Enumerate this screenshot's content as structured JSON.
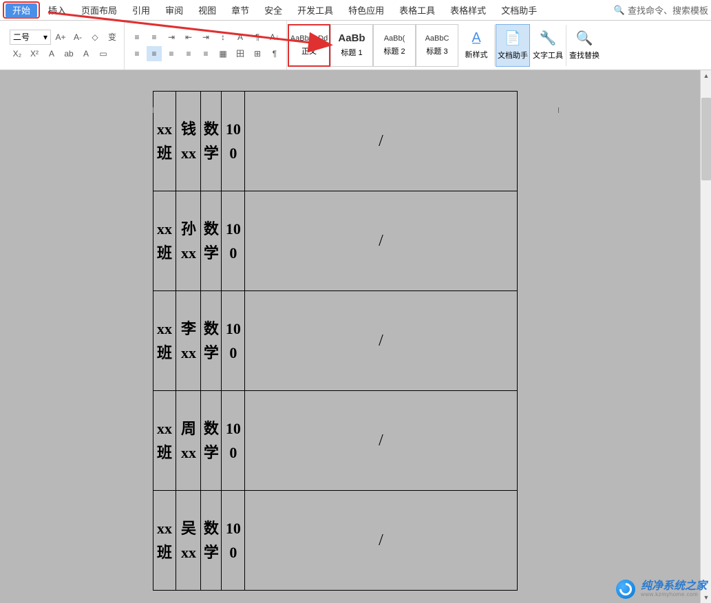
{
  "menu": {
    "items": [
      "开始",
      "插入",
      "页面布局",
      "引用",
      "审阅",
      "视图",
      "章节",
      "安全",
      "开发工具",
      "特色应用",
      "表格工具",
      "表格样式",
      "文档助手"
    ],
    "search_placeholder": "查找命令、搜索模板"
  },
  "ribbon": {
    "font_size": "二号",
    "a_plus": "A+",
    "a_minus": "A-",
    "clear_fmt": "◇",
    "phonetic": "变",
    "row2": {
      "sub": "X₂",
      "sup": "X²",
      "fontA": "A",
      "highlight": "ab",
      "fontcolor": "A",
      "brush": "▭"
    },
    "para": {
      "bullets": "≡",
      "numbers": "≡",
      "align_dec": "⇥",
      "indent_dec": "⇤",
      "indent_inc": "⇥",
      "linespace": "↕",
      "align_l": "≡",
      "align_c": "≡",
      "align_r": "≡",
      "justify": "≡",
      "dist": "≡",
      "shade": "▦",
      "border": "田",
      "para_btn": "¶",
      "sort": "A↓"
    },
    "styles": [
      {
        "preview": "AaBbCcDd",
        "name": "正文",
        "bold": false,
        "selected": true
      },
      {
        "preview": "AaBb",
        "name": "标题 1",
        "bold": true,
        "selected": false
      },
      {
        "preview": "AaBb(",
        "name": "标题 2",
        "bold": false,
        "selected": false
      },
      {
        "preview": "AaBbC",
        "name": "标题 3",
        "bold": false,
        "selected": false
      }
    ],
    "new_style": "新样式",
    "doc_assist": "文档助手",
    "text_tools": "文字工具",
    "find_replace": "查找替换"
  },
  "table": {
    "rows": [
      {
        "c1a": "xx",
        "c1b": "班",
        "c2a": "钱",
        "c2b": "xx",
        "c3a": "数",
        "c3b": "学",
        "c4a": "10",
        "c4b": "0",
        "c5": "/"
      },
      {
        "c1a": "xx",
        "c1b": "班",
        "c2a": "孙",
        "c2b": "xx",
        "c3a": "数",
        "c3b": "学",
        "c4a": "10",
        "c4b": "0",
        "c5": "/"
      },
      {
        "c1a": "xx",
        "c1b": "班",
        "c2a": "李",
        "c2b": "xx",
        "c3a": "数",
        "c3b": "学",
        "c4a": "10",
        "c4b": "0",
        "c5": "/"
      },
      {
        "c1a": "xx",
        "c1b": "班",
        "c2a": "周",
        "c2b": "xx",
        "c3a": "数",
        "c3b": "学",
        "c4a": "10",
        "c4b": "0",
        "c5": "/"
      },
      {
        "c1a": "xx",
        "c1b": "班",
        "c2a": "吴",
        "c2b": "xx",
        "c3a": "数",
        "c3b": "学",
        "c4a": "10",
        "c4b": "0",
        "c5": "/"
      }
    ]
  },
  "watermark": {
    "big": "纯净系统之家",
    "small": "www.kzmyhome.com"
  }
}
